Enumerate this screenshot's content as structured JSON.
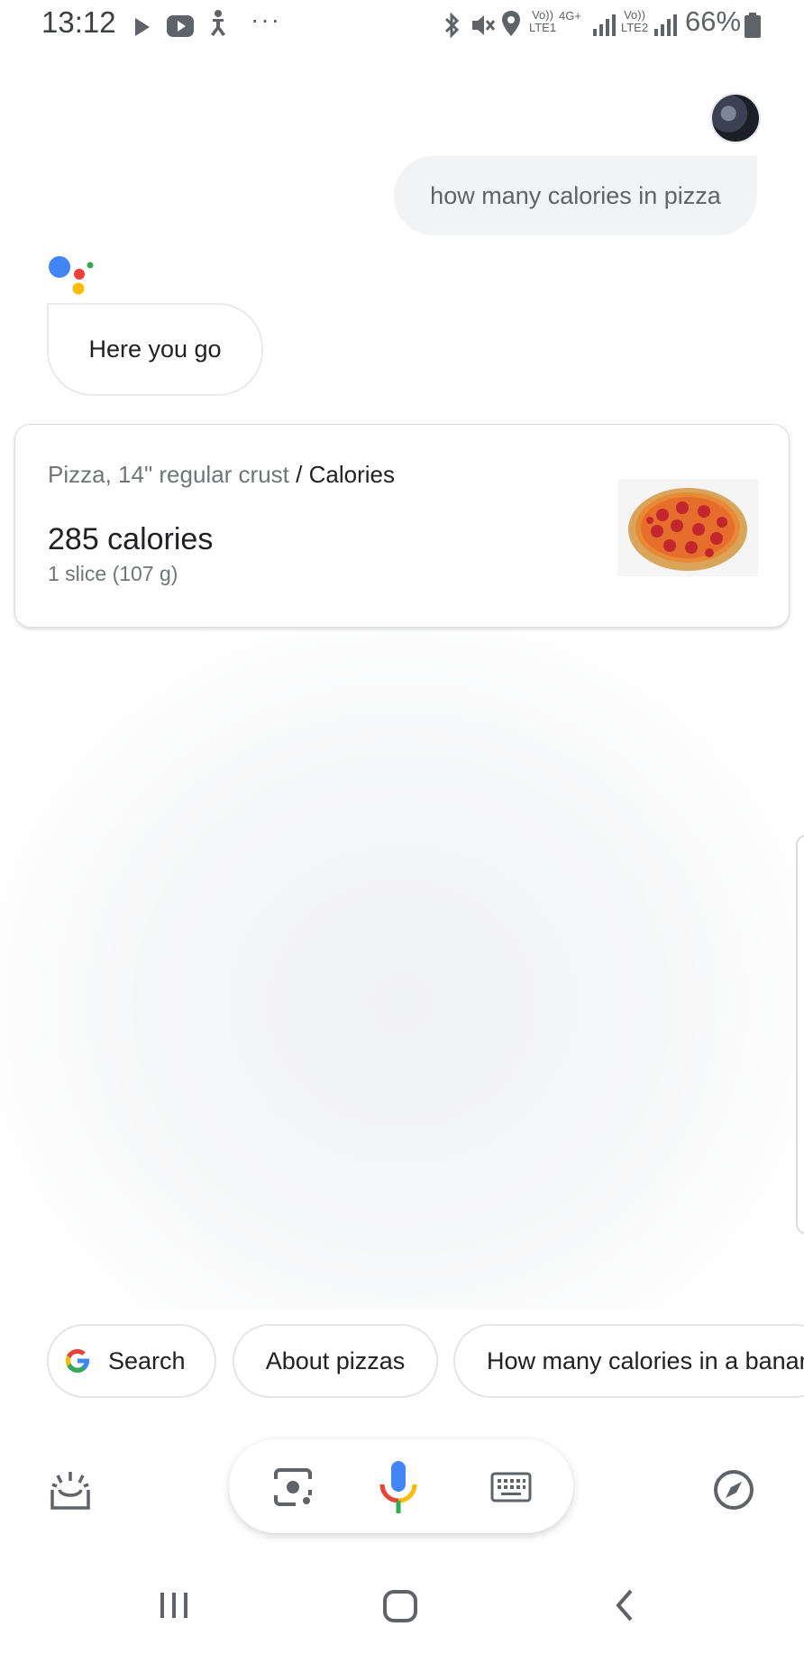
{
  "status_bar": {
    "time": "13:12",
    "battery_percent": "66%",
    "lte1_label": "LTE1",
    "lte2_label": "LTE2",
    "volte_label": "Vo))",
    "network_label": "4G+",
    "icons": [
      "play-icon",
      "youtube-icon",
      "accessibility-icon",
      "more-icon",
      "bluetooth-icon",
      "mute-icon",
      "location-icon",
      "signal-icon",
      "battery-icon"
    ]
  },
  "conversation": {
    "user_query": "how many calories in pizza",
    "assistant_reply": "Here you go"
  },
  "result_card": {
    "food": "Pizza, 14\" regular crust",
    "separator": "/",
    "category": "Calories",
    "value": "285 calories",
    "serving": "1 slice (107 g)",
    "image": "pepperoni-pizza"
  },
  "suggestions": [
    {
      "label": "Search",
      "icon": "google-g-icon"
    },
    {
      "label": "About pizzas"
    },
    {
      "label": "How many calories in a banan"
    }
  ],
  "colors": {
    "google_blue": "#4285F4",
    "google_red": "#EA4335",
    "google_yellow": "#FBBC05",
    "google_green": "#34A853"
  }
}
